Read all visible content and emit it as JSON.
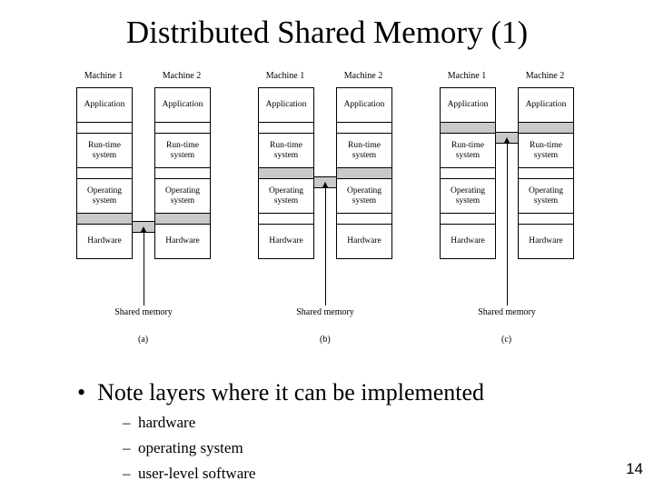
{
  "title": "Distributed Shared Memory (1)",
  "labels": {
    "machine1": "Machine 1",
    "machine2": "Machine 2",
    "application": "Application",
    "runtime": "Run-time\nsystem",
    "os": "Operating\nsystem",
    "hardware": "Hardware",
    "shared": "Shared memory",
    "a": "(a)",
    "b": "(b)",
    "c": "(c)"
  },
  "bullets": {
    "main": "Note layers where it can be implemented",
    "sub1": "hardware",
    "sub2": "operating system",
    "sub3": "user-level software"
  },
  "page_number": "14"
}
